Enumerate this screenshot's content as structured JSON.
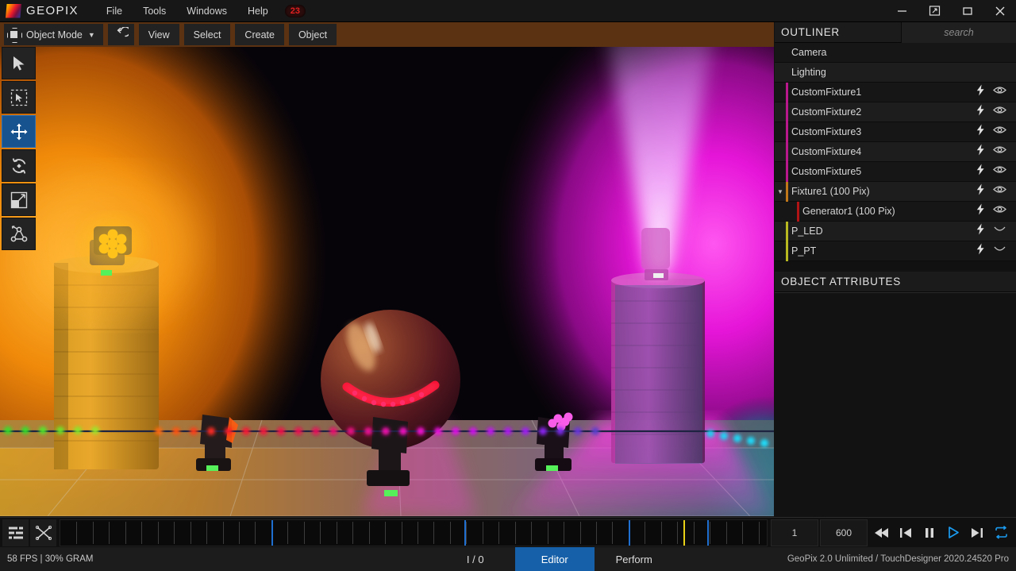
{
  "app": {
    "logo_text": "GEOPIX",
    "menus": [
      {
        "label": "File"
      },
      {
        "label": "Tools"
      },
      {
        "label": "Windows"
      },
      {
        "label": "Help"
      }
    ],
    "notification_badge": "23",
    "window_controls": [
      {
        "name": "minimize-button",
        "glyph": "—"
      },
      {
        "name": "fullscreen-button",
        "glyph": "⤡"
      },
      {
        "name": "maximize-button",
        "glyph": "□"
      },
      {
        "name": "close-button",
        "glyph": "✕"
      }
    ]
  },
  "modebar": {
    "mode_label": "Object Mode",
    "mode_caret": "▼",
    "undo_label": "Undo",
    "buttons": [
      {
        "label": "View"
      },
      {
        "label": "Select"
      },
      {
        "label": "Create"
      },
      {
        "label": "Object"
      }
    ]
  },
  "tools": [
    {
      "name": "select-cursor-tool",
      "label": "Select",
      "active": false
    },
    {
      "name": "box-select-tool",
      "label": "Box Select",
      "active": false
    },
    {
      "name": "move-tool",
      "label": "Move",
      "active": true
    },
    {
      "name": "rotate-tool",
      "label": "Rotate",
      "active": false
    },
    {
      "name": "scale-tool",
      "label": "Scale",
      "active": false
    },
    {
      "name": "snap-node-tool",
      "label": "Snap / Node",
      "active": false
    }
  ],
  "outliner": {
    "title": "OUTLINER",
    "search_placeholder": "search",
    "search_value": "",
    "items": [
      {
        "label": "Camera",
        "color": "",
        "indent": 0,
        "icons": false,
        "expander": "",
        "eye": ""
      },
      {
        "label": "Lighting",
        "color": "",
        "indent": 0,
        "icons": false,
        "expander": "",
        "eye": ""
      },
      {
        "label": "CustomFixture1",
        "color": "#b8188c",
        "indent": 0,
        "icons": true,
        "expander": "",
        "eye": "open"
      },
      {
        "label": "CustomFixture2",
        "color": "#b8188c",
        "indent": 0,
        "icons": true,
        "expander": "",
        "eye": "open"
      },
      {
        "label": "CustomFixture3",
        "color": "#b8188c",
        "indent": 0,
        "icons": true,
        "expander": "",
        "eye": "open"
      },
      {
        "label": "CustomFixture4",
        "color": "#b8188c",
        "indent": 0,
        "icons": true,
        "expander": "",
        "eye": "open"
      },
      {
        "label": "CustomFixture5",
        "color": "#b8188c",
        "indent": 0,
        "icons": true,
        "expander": "",
        "eye": "open"
      },
      {
        "label": "Fixture1 (100 Pix)",
        "color": "#c07818",
        "indent": 0,
        "icons": true,
        "expander": "▼",
        "eye": "open"
      },
      {
        "label": "Generator1 (100 Pix)",
        "color": "#b01414",
        "indent": 1,
        "icons": true,
        "expander": "",
        "eye": "open"
      },
      {
        "label": "P_LED",
        "color": "#b8b820",
        "indent": 0,
        "icons": true,
        "expander": "",
        "eye": "closed"
      },
      {
        "label": "P_PT",
        "color": "#b8b820",
        "indent": 0,
        "icons": true,
        "expander": "",
        "eye": "closed"
      }
    ]
  },
  "attributes": {
    "title": "OBJECT ATTRIBUTES"
  },
  "timeline": {
    "layers_icon_label": "Layers",
    "crossfade_icon_label": "Crossfade",
    "current_frame": "1",
    "end_frame": "600",
    "transport": [
      {
        "name": "rewind-button",
        "label": "Rewind",
        "accent": false
      },
      {
        "name": "jump-start-button",
        "label": "Jump to Start",
        "accent": false
      },
      {
        "name": "pause-button",
        "label": "Pause",
        "accent": false
      },
      {
        "name": "play-button",
        "label": "Play",
        "accent": true
      },
      {
        "name": "jump-end-button",
        "label": "Jump to End",
        "accent": false
      },
      {
        "name": "loop-button",
        "label": "Loop",
        "accent": true
      }
    ]
  },
  "statusbar": {
    "performance": "58 FPS | 30% GRAM",
    "tabs": [
      {
        "label": "I / 0",
        "active": false
      },
      {
        "label": "Editor",
        "active": true
      },
      {
        "label": "Perform",
        "active": false
      }
    ],
    "version": "GeoPix 2.0 Unlimited / TouchDesigner 2020.24520 Pro"
  },
  "colors": {
    "accent_blue": "#1560a8",
    "mode_toolbar": "#5c3312",
    "badge_red": "#e02020",
    "amber_light": "#ffab17",
    "magenta_light": "#ee17dd",
    "cyan_light": "#19c8e0",
    "red_light": "#ff1030"
  },
  "viewport": {
    "scene_name": "3D Lighting Preview",
    "description": "Stage visualization with amber, magenta and cyan lit brick pillars, a reflective sphere with LED smile arc, moving-head fixtures and LED pixel strip"
  }
}
